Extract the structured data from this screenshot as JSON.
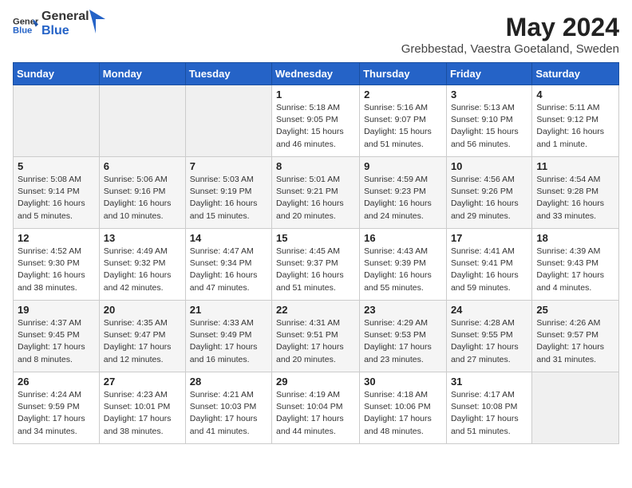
{
  "header": {
    "logo_line1": "General",
    "logo_line2": "Blue",
    "month_title": "May 2024",
    "subtitle": "Grebbestad, Vaestra Goetaland, Sweden"
  },
  "weekdays": [
    "Sunday",
    "Monday",
    "Tuesday",
    "Wednesday",
    "Thursday",
    "Friday",
    "Saturday"
  ],
  "weeks": [
    [
      {
        "day": "",
        "sunrise": "",
        "sunset": "",
        "daylight": ""
      },
      {
        "day": "",
        "sunrise": "",
        "sunset": "",
        "daylight": ""
      },
      {
        "day": "",
        "sunrise": "",
        "sunset": "",
        "daylight": ""
      },
      {
        "day": "1",
        "sunrise": "Sunrise: 5:18 AM",
        "sunset": "Sunset: 9:05 PM",
        "daylight": "Daylight: 15 hours and 46 minutes."
      },
      {
        "day": "2",
        "sunrise": "Sunrise: 5:16 AM",
        "sunset": "Sunset: 9:07 PM",
        "daylight": "Daylight: 15 hours and 51 minutes."
      },
      {
        "day": "3",
        "sunrise": "Sunrise: 5:13 AM",
        "sunset": "Sunset: 9:10 PM",
        "daylight": "Daylight: 15 hours and 56 minutes."
      },
      {
        "day": "4",
        "sunrise": "Sunrise: 5:11 AM",
        "sunset": "Sunset: 9:12 PM",
        "daylight": "Daylight: 16 hours and 1 minute."
      }
    ],
    [
      {
        "day": "5",
        "sunrise": "Sunrise: 5:08 AM",
        "sunset": "Sunset: 9:14 PM",
        "daylight": "Daylight: 16 hours and 5 minutes."
      },
      {
        "day": "6",
        "sunrise": "Sunrise: 5:06 AM",
        "sunset": "Sunset: 9:16 PM",
        "daylight": "Daylight: 16 hours and 10 minutes."
      },
      {
        "day": "7",
        "sunrise": "Sunrise: 5:03 AM",
        "sunset": "Sunset: 9:19 PM",
        "daylight": "Daylight: 16 hours and 15 minutes."
      },
      {
        "day": "8",
        "sunrise": "Sunrise: 5:01 AM",
        "sunset": "Sunset: 9:21 PM",
        "daylight": "Daylight: 16 hours and 20 minutes."
      },
      {
        "day": "9",
        "sunrise": "Sunrise: 4:59 AM",
        "sunset": "Sunset: 9:23 PM",
        "daylight": "Daylight: 16 hours and 24 minutes."
      },
      {
        "day": "10",
        "sunrise": "Sunrise: 4:56 AM",
        "sunset": "Sunset: 9:26 PM",
        "daylight": "Daylight: 16 hours and 29 minutes."
      },
      {
        "day": "11",
        "sunrise": "Sunrise: 4:54 AM",
        "sunset": "Sunset: 9:28 PM",
        "daylight": "Daylight: 16 hours and 33 minutes."
      }
    ],
    [
      {
        "day": "12",
        "sunrise": "Sunrise: 4:52 AM",
        "sunset": "Sunset: 9:30 PM",
        "daylight": "Daylight: 16 hours and 38 minutes."
      },
      {
        "day": "13",
        "sunrise": "Sunrise: 4:49 AM",
        "sunset": "Sunset: 9:32 PM",
        "daylight": "Daylight: 16 hours and 42 minutes."
      },
      {
        "day": "14",
        "sunrise": "Sunrise: 4:47 AM",
        "sunset": "Sunset: 9:34 PM",
        "daylight": "Daylight: 16 hours and 47 minutes."
      },
      {
        "day": "15",
        "sunrise": "Sunrise: 4:45 AM",
        "sunset": "Sunset: 9:37 PM",
        "daylight": "Daylight: 16 hours and 51 minutes."
      },
      {
        "day": "16",
        "sunrise": "Sunrise: 4:43 AM",
        "sunset": "Sunset: 9:39 PM",
        "daylight": "Daylight: 16 hours and 55 minutes."
      },
      {
        "day": "17",
        "sunrise": "Sunrise: 4:41 AM",
        "sunset": "Sunset: 9:41 PM",
        "daylight": "Daylight: 16 hours and 59 minutes."
      },
      {
        "day": "18",
        "sunrise": "Sunrise: 4:39 AM",
        "sunset": "Sunset: 9:43 PM",
        "daylight": "Daylight: 17 hours and 4 minutes."
      }
    ],
    [
      {
        "day": "19",
        "sunrise": "Sunrise: 4:37 AM",
        "sunset": "Sunset: 9:45 PM",
        "daylight": "Daylight: 17 hours and 8 minutes."
      },
      {
        "day": "20",
        "sunrise": "Sunrise: 4:35 AM",
        "sunset": "Sunset: 9:47 PM",
        "daylight": "Daylight: 17 hours and 12 minutes."
      },
      {
        "day": "21",
        "sunrise": "Sunrise: 4:33 AM",
        "sunset": "Sunset: 9:49 PM",
        "daylight": "Daylight: 17 hours and 16 minutes."
      },
      {
        "day": "22",
        "sunrise": "Sunrise: 4:31 AM",
        "sunset": "Sunset: 9:51 PM",
        "daylight": "Daylight: 17 hours and 20 minutes."
      },
      {
        "day": "23",
        "sunrise": "Sunrise: 4:29 AM",
        "sunset": "Sunset: 9:53 PM",
        "daylight": "Daylight: 17 hours and 23 minutes."
      },
      {
        "day": "24",
        "sunrise": "Sunrise: 4:28 AM",
        "sunset": "Sunset: 9:55 PM",
        "daylight": "Daylight: 17 hours and 27 minutes."
      },
      {
        "day": "25",
        "sunrise": "Sunrise: 4:26 AM",
        "sunset": "Sunset: 9:57 PM",
        "daylight": "Daylight: 17 hours and 31 minutes."
      }
    ],
    [
      {
        "day": "26",
        "sunrise": "Sunrise: 4:24 AM",
        "sunset": "Sunset: 9:59 PM",
        "daylight": "Daylight: 17 hours and 34 minutes."
      },
      {
        "day": "27",
        "sunrise": "Sunrise: 4:23 AM",
        "sunset": "Sunset: 10:01 PM",
        "daylight": "Daylight: 17 hours and 38 minutes."
      },
      {
        "day": "28",
        "sunrise": "Sunrise: 4:21 AM",
        "sunset": "Sunset: 10:03 PM",
        "daylight": "Daylight: 17 hours and 41 minutes."
      },
      {
        "day": "29",
        "sunrise": "Sunrise: 4:19 AM",
        "sunset": "Sunset: 10:04 PM",
        "daylight": "Daylight: 17 hours and 44 minutes."
      },
      {
        "day": "30",
        "sunrise": "Sunrise: 4:18 AM",
        "sunset": "Sunset: 10:06 PM",
        "daylight": "Daylight: 17 hours and 48 minutes."
      },
      {
        "day": "31",
        "sunrise": "Sunrise: 4:17 AM",
        "sunset": "Sunset: 10:08 PM",
        "daylight": "Daylight: 17 hours and 51 minutes."
      },
      {
        "day": "",
        "sunrise": "",
        "sunset": "",
        "daylight": ""
      }
    ]
  ]
}
